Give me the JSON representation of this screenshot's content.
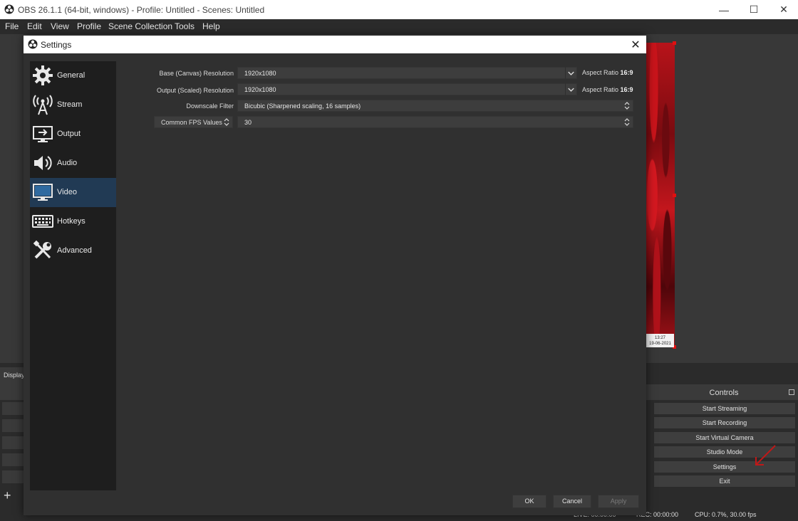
{
  "window": {
    "title": "OBS 26.1.1 (64-bit, windows) - Profile: Untitled - Scenes: Untitled",
    "minimize": "—",
    "maximize": "☐",
    "close": "✕"
  },
  "menu": [
    "File",
    "Edit",
    "View",
    "Profile",
    "Scene Collection",
    "Tools",
    "Help"
  ],
  "preview": {
    "time": "13:27",
    "date": "19-06-2021"
  },
  "dock": {
    "display_tab": "Display",
    "plus": "+"
  },
  "controls": {
    "title": "Controls",
    "buttons": [
      "Start Streaming",
      "Start Recording",
      "Start Virtual Camera",
      "Studio Mode",
      "Settings",
      "Exit"
    ]
  },
  "status": {
    "live": "LIVE: 00:00:00",
    "rec": "REC: 00:00:00",
    "cpu": "CPU: 0.7%, 30.00 fps"
  },
  "settings": {
    "title": "Settings",
    "close": "✕",
    "nav": [
      {
        "label": "General",
        "icon": "gear-icon"
      },
      {
        "label": "Stream",
        "icon": "broadcast-antenna-icon"
      },
      {
        "label": "Output",
        "icon": "output-monitor-icon"
      },
      {
        "label": "Audio",
        "icon": "speaker-icon"
      },
      {
        "label": "Video",
        "icon": "monitor-icon"
      },
      {
        "label": "Hotkeys",
        "icon": "keyboard-icon"
      },
      {
        "label": "Advanced",
        "icon": "tools-icon"
      }
    ],
    "active_nav": "Video",
    "video": {
      "base_label": "Base (Canvas) Resolution",
      "base_value": "1920x1080",
      "base_aspect_label": "Aspect Ratio",
      "base_aspect_value": "16:9",
      "output_label": "Output (Scaled) Resolution",
      "output_value": "1920x1080",
      "output_aspect_label": "Aspect Ratio",
      "output_aspect_value": "16:9",
      "downscale_label": "Downscale Filter",
      "downscale_value": "Bicubic (Sharpened scaling, 16 samples)",
      "fps_mode": "Common FPS Values",
      "fps_value": "30"
    },
    "buttons": {
      "ok": "OK",
      "cancel": "Cancel",
      "apply": "Apply"
    }
  },
  "colors": {
    "background": "#2b2b2b",
    "dialog": "#303030",
    "nav": "#1e1e1e",
    "nav_active": "#213a54",
    "preview_border": "#e01010"
  }
}
